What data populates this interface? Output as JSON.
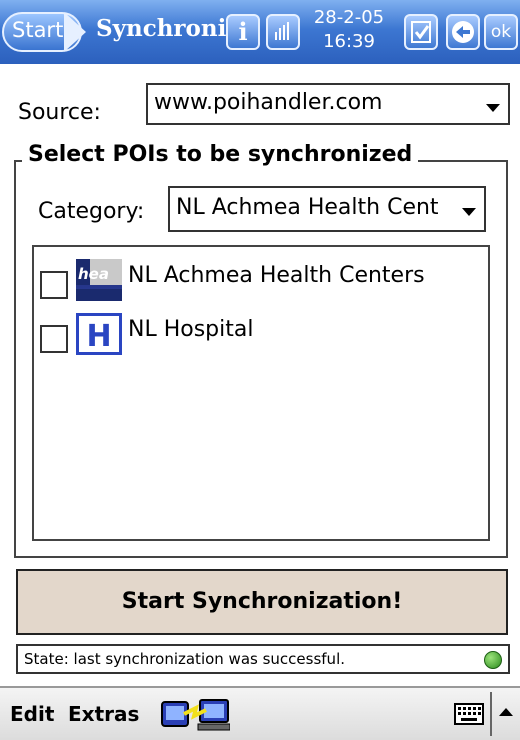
{
  "taskbar": {
    "start_label": "Start",
    "title": "Synchroni",
    "info_icon": "info-icon",
    "signal_icon": "signal-icon",
    "date": "28-2-05",
    "time": "16:39",
    "ok_label": "ok"
  },
  "source": {
    "label": "Source:",
    "value": "www.poihandler.com"
  },
  "group": {
    "title": "Select POIs to be synchronized",
    "category_label": "Category:",
    "category_value": "NL Achmea Health Cent",
    "items": [
      {
        "label": "NL Achmea Health Centers",
        "icon": "health-icon",
        "checked": false
      },
      {
        "label": "NL Hospital",
        "icon": "hospital-icon",
        "checked": false
      }
    ]
  },
  "sync_button_label": "Start Synchronization!",
  "status_text": "State: last synchronization was successful.",
  "menubar": {
    "edit": "Edit",
    "extras": "Extras"
  },
  "colors": {
    "taskbar": "#3d77d2",
    "button": "#e3d7cb",
    "status_ok": "#2a8a1c"
  }
}
